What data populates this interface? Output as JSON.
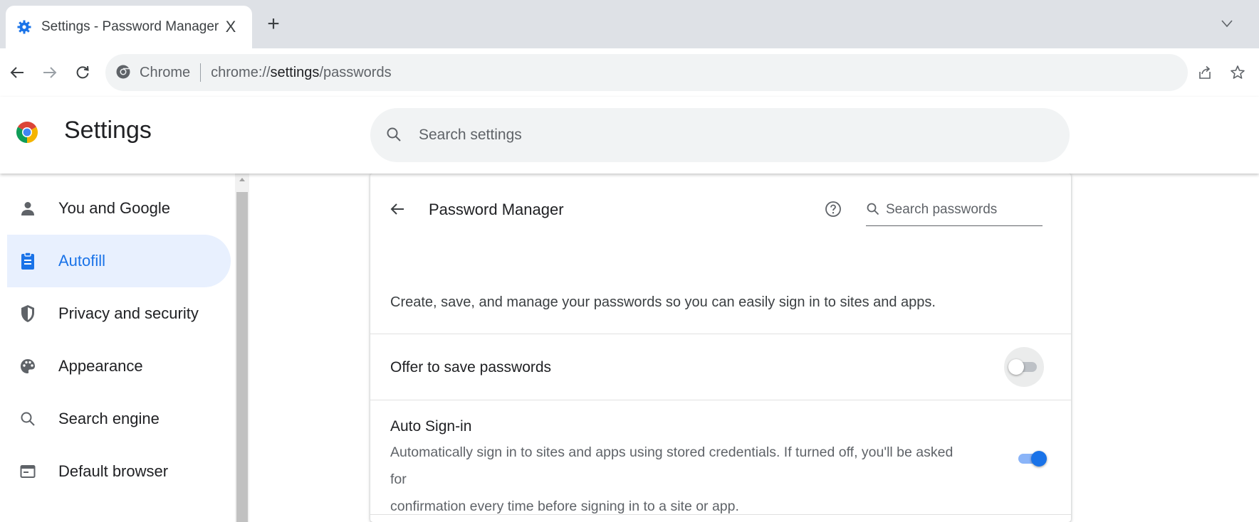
{
  "tab": {
    "title": "Settings - Password Manager",
    "close_glyph": "X",
    "new_tab_glyph": "+"
  },
  "toolbar": {
    "site_chip": "Chrome",
    "url_prefix": "chrome://",
    "url_bold": "settings",
    "url_suffix": "/passwords"
  },
  "header": {
    "title": "Settings",
    "search_placeholder": "Search settings"
  },
  "sidebar": {
    "items": [
      {
        "label": "You and Google",
        "icon": "person-icon",
        "active": false
      },
      {
        "label": "Autofill",
        "icon": "clipboard-icon",
        "active": true
      },
      {
        "label": "Privacy and security",
        "icon": "shield-icon",
        "active": false
      },
      {
        "label": "Appearance",
        "icon": "palette-icon",
        "active": false
      },
      {
        "label": "Search engine",
        "icon": "search-icon",
        "active": false
      },
      {
        "label": "Default browser",
        "icon": "browser-window-icon",
        "active": false
      }
    ]
  },
  "main": {
    "title": "Password Manager",
    "search_placeholder": "Search passwords",
    "description": "Create, save, and manage your passwords so you can easily sign in to sites and apps.",
    "offer_to_save": {
      "label": "Offer to save passwords",
      "enabled": false
    },
    "auto_signin": {
      "label": "Auto Sign-in",
      "description_line1": "Automatically sign in to sites and apps using stored credentials. If turned off, you'll be asked for",
      "description_line2": "confirmation every time before signing in to a site or app.",
      "enabled": true
    }
  },
  "colors": {
    "accent": "#1a73e8",
    "active_bg": "#e8f0fe",
    "tabstrip": "#dee1e6"
  }
}
